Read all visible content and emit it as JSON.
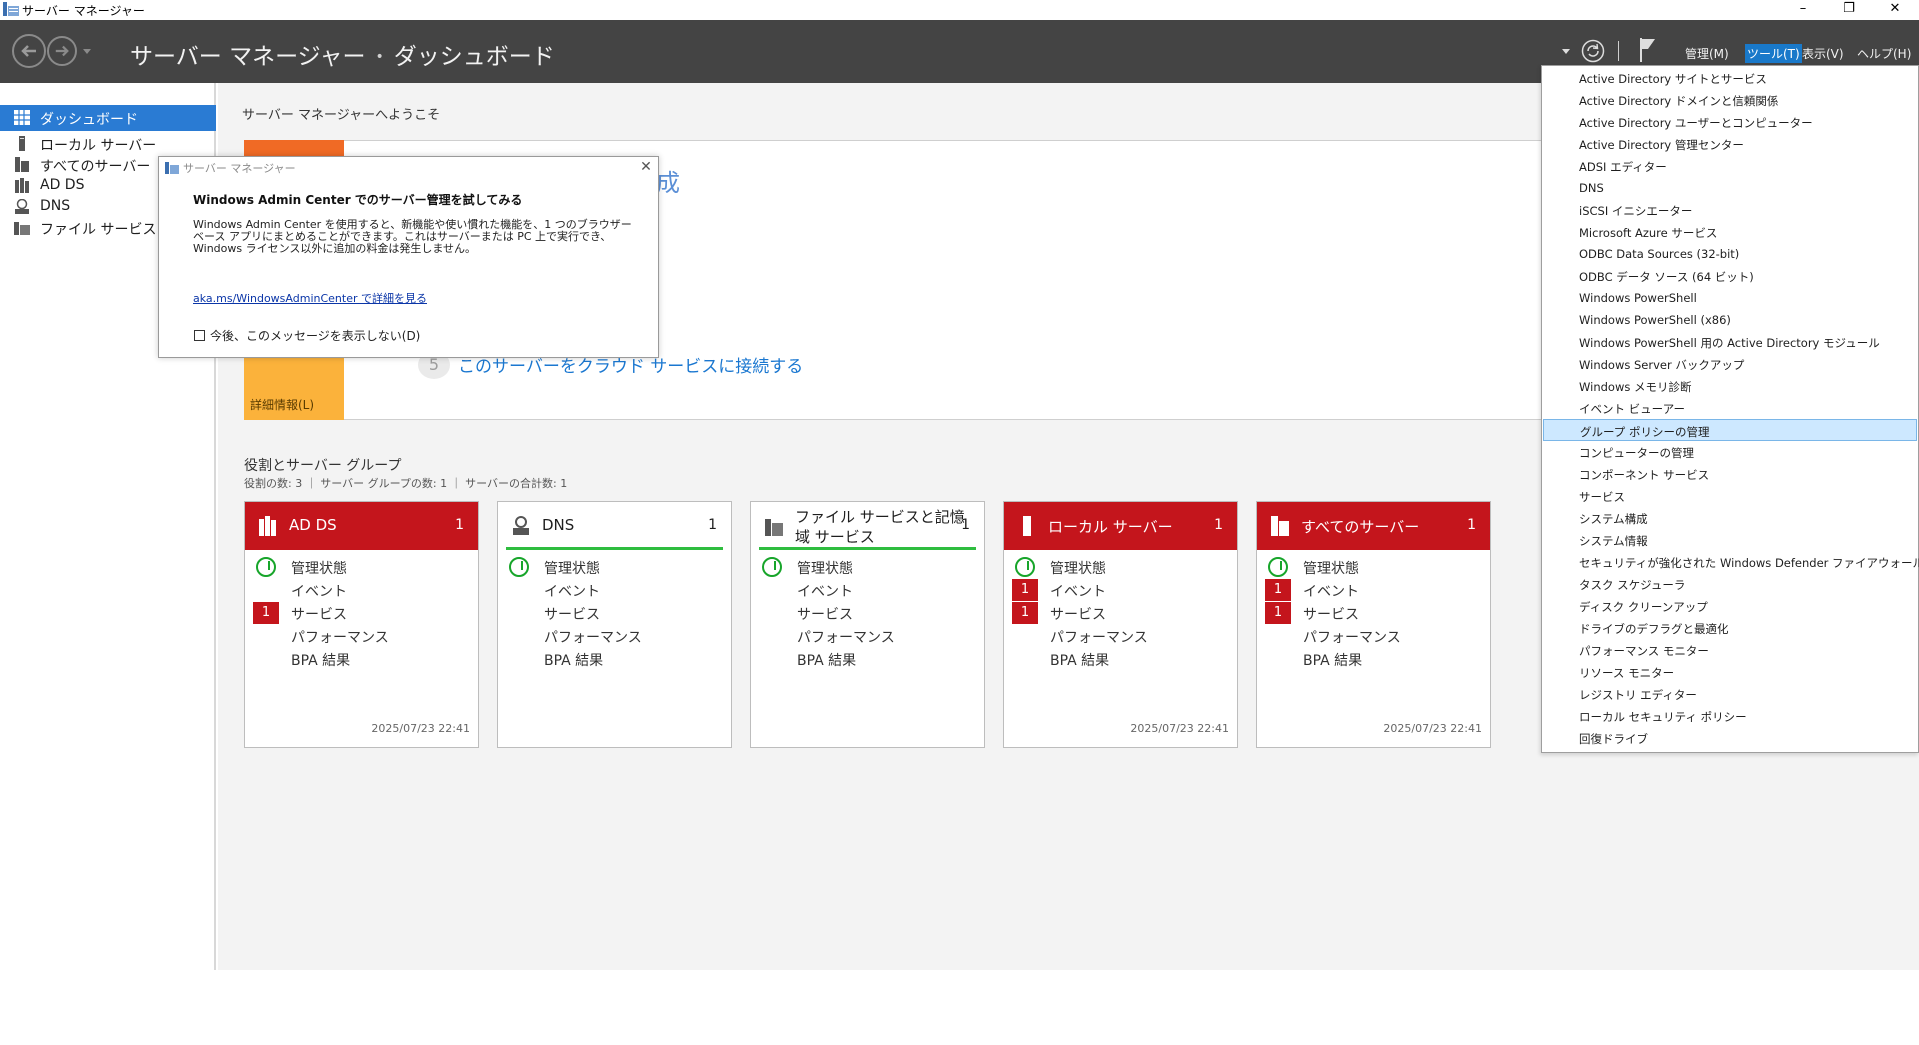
{
  "window": {
    "title": "サーバー マネージャー",
    "minimize": "–",
    "restore": "❐",
    "close": "✕"
  },
  "header": {
    "breadcrumb_root": "サーバー マネージャー",
    "breadcrumb_sep": "•",
    "breadcrumb_current": "ダッシュボード",
    "menus": {
      "manage": "管理(M)",
      "tools": "ツール(T)",
      "view": "表示(V)",
      "help": "ヘルプ(H)"
    },
    "accent": "#1979ca"
  },
  "leftnav": {
    "items": [
      {
        "label": "ダッシュボード",
        "selected": true
      },
      {
        "label": "ローカル サーバー"
      },
      {
        "label": "すべてのサーバー"
      },
      {
        "label": "AD DS"
      },
      {
        "label": "DNS"
      },
      {
        "label": "ファイル サービスと記憶域サービス"
      }
    ]
  },
  "welcome": {
    "title": "サーバー マネージャーへようこそ",
    "quick_start_fragment": "成",
    "step5_number": "5",
    "step5_text": "このサーバーをクラウド サービスに接続する",
    "more_info": "詳細情報(L)"
  },
  "groups": {
    "title": "役割とサーバー グループ",
    "stats": "役割の数: 3 ｜ サーバー グループの数: 1 ｜ サーバーの合計数: 1",
    "tiles": [
      {
        "name": "AD DS",
        "count": "1",
        "status": "red",
        "rows": [
          {
            "label": "管理状態",
            "ok": true
          },
          {
            "label": "イベント"
          },
          {
            "label": "サービス",
            "badge": "1"
          },
          {
            "label": "パフォーマンス"
          },
          {
            "label": "BPA 結果"
          }
        ],
        "timestamp": "2025/07/23 22:41"
      },
      {
        "name": "DNS",
        "count": "1",
        "status": "green",
        "rows": [
          {
            "label": "管理状態",
            "ok": true
          },
          {
            "label": "イベント"
          },
          {
            "label": "サービス"
          },
          {
            "label": "パフォーマンス"
          },
          {
            "label": "BPA 結果"
          }
        ],
        "timestamp": ""
      },
      {
        "name": "ファイル サービスと記憶域 サービス",
        "count": "1",
        "status": "green",
        "rows": [
          {
            "label": "管理状態",
            "ok": true
          },
          {
            "label": "イベント"
          },
          {
            "label": "サービス"
          },
          {
            "label": "パフォーマンス"
          },
          {
            "label": "BPA 結果"
          }
        ],
        "timestamp": ""
      },
      {
        "name": "ローカル サーバー",
        "count": "1",
        "status": "red",
        "rows": [
          {
            "label": "管理状態",
            "ok": true
          },
          {
            "label": "イベント",
            "badge": "1"
          },
          {
            "label": "サービス",
            "badge": "1"
          },
          {
            "label": "パフォーマンス"
          },
          {
            "label": "BPA 結果"
          }
        ],
        "timestamp": "2025/07/23 22:41"
      },
      {
        "name": "すべてのサーバー",
        "count": "1",
        "status": "red",
        "rows": [
          {
            "label": "管理状態",
            "ok": true
          },
          {
            "label": "イベント",
            "badge": "1"
          },
          {
            "label": "サービス",
            "badge": "1"
          },
          {
            "label": "パフォーマンス"
          },
          {
            "label": "BPA 結果"
          }
        ],
        "timestamp": "2025/07/23 22:41"
      }
    ]
  },
  "dialog": {
    "title": "サーバー マネージャー",
    "heading": "Windows Admin Center でのサーバー管理を試してみる",
    "body": "Windows Admin Center を使用すると、新機能や使い慣れた機能を、1 つのブラウザー ベース アプリにまとめることができます。これはサーバーまたは PC 上で実行でき、Windows ライセンス以外に追加の料金は発生しません。",
    "link": "aka.ms/WindowsAdminCenter で詳細を見る",
    "checkbox_label": "今後、このメッセージを表示しない(D)",
    "close": "✕"
  },
  "tools_menu": {
    "items": [
      "Active Directory サイトとサービス",
      "Active Directory ドメインと信頼関係",
      "Active Directory ユーザーとコンピューター",
      "Active Directory 管理センター",
      "ADSI エディター",
      "DNS",
      "iSCSI イニシエーター",
      "Microsoft Azure サービス",
      "ODBC Data Sources (32-bit)",
      "ODBC データ ソース (64 ビット)",
      "Windows PowerShell",
      "Windows PowerShell (x86)",
      "Windows PowerShell 用の Active Directory モジュール",
      "Windows Server バックアップ",
      "Windows メモリ診断",
      "イベント ビューアー",
      "グループ ポリシーの管理",
      "コンピューターの管理",
      "コンポーネント サービス",
      "サービス",
      "システム構成",
      "システム情報",
      "セキュリティが強化された Windows Defender ファイアウォール",
      "タスク スケジューラ",
      "ディスク クリーンアップ",
      "ドライブのデフラグと最適化",
      "パフォーマンス モニター",
      "リソース モニター",
      "レジストリ エディター",
      "ローカル セキュリティ ポリシー",
      "回復ドライブ"
    ],
    "selected": "グループ ポリシーの管理"
  },
  "colors": {
    "header_bg": "#444444",
    "nav_selected": "#2a7bd3",
    "tile_red": "#c4151c",
    "tile_green": "#2fbd3f",
    "orange": "#f06a25",
    "amber": "#fbb23b"
  }
}
